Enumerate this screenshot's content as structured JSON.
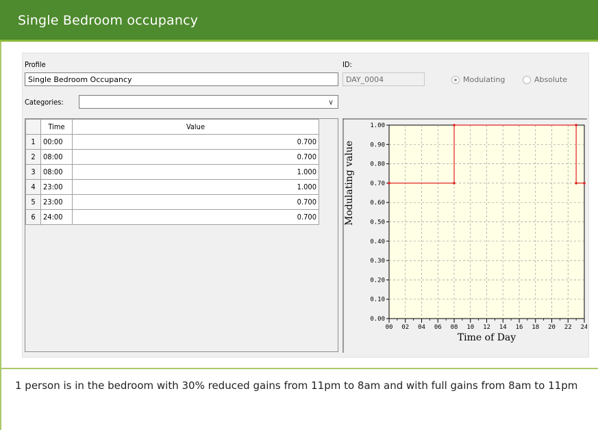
{
  "header": {
    "title": "Single Bedroom occupancy"
  },
  "form": {
    "profile_label": "Profile",
    "profile_value": "Single Bedroom Occupancy",
    "id_label": "ID:",
    "id_value": "DAY_0004",
    "modulating_label": "Modulating",
    "absolute_label": "Absolute",
    "selected_mode": "Modulating",
    "categories_label": "Categories:",
    "categories_value": ""
  },
  "table": {
    "headers": [
      "Time",
      "Value"
    ],
    "rows": [
      {
        "num": "1",
        "time": "00:00",
        "value": "0.700"
      },
      {
        "num": "2",
        "time": "08:00",
        "value": "0.700"
      },
      {
        "num": "3",
        "time": "08:00",
        "value": "1.000"
      },
      {
        "num": "4",
        "time": "23:00",
        "value": "1.000"
      },
      {
        "num": "5",
        "time": "23:00",
        "value": "0.700"
      },
      {
        "num": "6",
        "time": "24:00",
        "value": "0.700"
      }
    ]
  },
  "chart_data": {
    "type": "line",
    "xlabel": "Time of Day",
    "ylabel": "Modulating value",
    "xlim": [
      0,
      24
    ],
    "ylim": [
      0,
      1
    ],
    "x_ticks": [
      "00",
      "02",
      "04",
      "06",
      "08",
      "10",
      "12",
      "14",
      "16",
      "18",
      "20",
      "22",
      "24"
    ],
    "y_ticks": [
      "0.00",
      "0.10",
      "0.20",
      "0.30",
      "0.40",
      "0.50",
      "0.60",
      "0.70",
      "0.80",
      "0.90",
      "1.00"
    ],
    "grid": true,
    "line_color": "#e02020",
    "background_color": "#ffffe6",
    "series": [
      {
        "x": [
          0,
          8,
          8,
          23,
          23,
          24
        ],
        "y": [
          0.7,
          0.7,
          1.0,
          1.0,
          0.7,
          0.7
        ]
      }
    ]
  },
  "description": "1 person is in the bedroom with 30% reduced gains from 11pm to 8am and with full gains from 8am to 11pm"
}
